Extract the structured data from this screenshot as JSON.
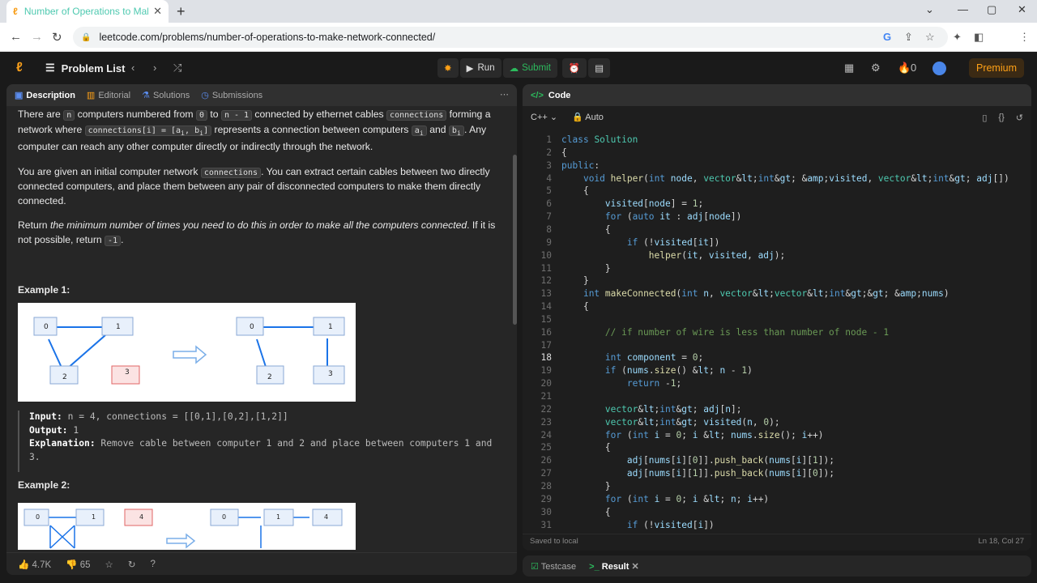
{
  "browser": {
    "tab_title": "Number of Operations to Make Network Connected",
    "url": "leetcode.com/problems/number-of-operations-to-make-network-connected/",
    "profile_initial": "g"
  },
  "nav": {
    "problem_list": "Problem List",
    "run": "Run",
    "submit": "Submit",
    "fire_count": "0",
    "premium": "Premium"
  },
  "left_tabs": [
    "Description",
    "Editorial",
    "Solutions",
    "Submissions"
  ],
  "desc": {
    "p1": [
      "There are ",
      "n",
      " computers numbered from ",
      "0",
      " to ",
      "n - 1",
      " connected by ethernet cables ",
      "connections",
      " forming a network where ",
      "connections[i] = [a",
      "i",
      ", b",
      "i",
      "]",
      " represents a connection between computers ",
      "a",
      "i",
      " and ",
      "b",
      "i",
      ". Any computer can reach any other computer directly or indirectly through the network."
    ],
    "p2": [
      "You are given an initial computer network ",
      "connections",
      ". You can extract certain cables between two directly connected computers, and place them between any pair of disconnected computers to make them directly connected."
    ],
    "p3": [
      "Return ",
      "the minimum number of times you need to do this in order to make all the computers connected",
      ". If it is not possible, return ",
      "-1",
      "."
    ],
    "ex1_title": "Example 1:",
    "ex1_input_label": "Input:",
    "ex1_input": " n = 4, connections = [[0,1],[0,2],[1,2]]",
    "ex1_output_label": "Output:",
    "ex1_output": " 1",
    "ex1_expl_label": "Explanation:",
    "ex1_expl": " Remove cable between computer 1 and 2 and place between computers 1 and 3.",
    "ex2_title": "Example 2:",
    "ex1_nodes_before": [
      "0",
      "1",
      "2",
      "3"
    ],
    "ex1_nodes_after": [
      "0",
      "1",
      "2",
      "3"
    ],
    "ex2_nodes": [
      "0",
      "1",
      "4",
      "0",
      "1",
      "4"
    ]
  },
  "bottom": {
    "likes": "4.7K",
    "dislikes": "65"
  },
  "editor": {
    "header": "Code",
    "language": "C++",
    "mode": "Auto",
    "saved": "Saved to local",
    "cursor": "Ln 18, Col 27"
  },
  "code_lines": [
    "class Solution",
    "{",
    "public:",
    "    void helper(int node, vector<int> &visited, vector<int> adj[])",
    "    {",
    "        visited[node] = 1;",
    "        for (auto it : adj[node])",
    "        {",
    "            if (!visited[it])",
    "                helper(it, visited, adj);",
    "        }",
    "    }",
    "    int makeConnected(int n, vector<vector<int>> &nums)",
    "    {",
    "",
    "        // if number of wire is less than number of node - 1",
    "",
    "        int component = 0;",
    "        if (nums.size() < n - 1)",
    "            return -1;",
    "",
    "        vector<int> adj[n];",
    "        vector<int> visited(n, 0);",
    "        for (int i = 0; i < nums.size(); i++)",
    "        {",
    "            adj[nums[i][0]].push_back(nums[i][1]);",
    "            adj[nums[i][1]].push_back(nums[i][0]);",
    "        }",
    "        for (int i = 0; i < n; i++)",
    "        {",
    "            if (!visited[i])"
  ],
  "bottom_tabs": {
    "testcase": "Testcase",
    "result": "Result"
  }
}
